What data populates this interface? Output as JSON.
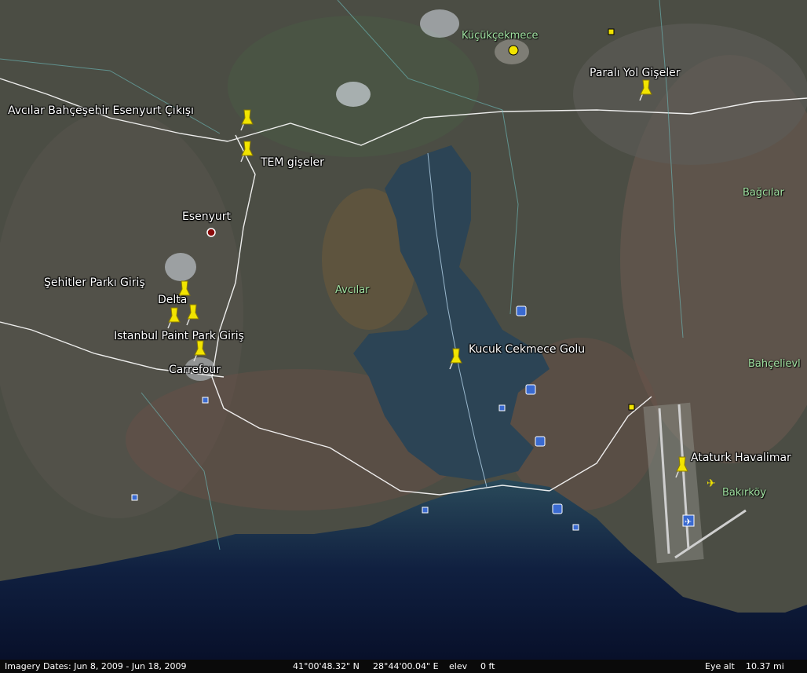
{
  "places": {
    "kucukcekmece": "Küçükçekmece",
    "bagcilar": "Bağcılar",
    "avcilar": "Avcılar",
    "bahcelievler": "Bahçelievl",
    "bakirkoy": "Bakırköy",
    "esenyurt": "Esenyurt"
  },
  "placemarks": {
    "avcilar_cikisi": "Avcılar Bahçeşehir Esenyurt Çıkışı",
    "tem_giseler": "TEM gişeler",
    "parali_yol": "Paralı Yol Gişeler",
    "sehitler_parki": "Şehitler Parkı Giriş",
    "delta": "Delta",
    "paint_park": "Istanbul Paint Park Giriş",
    "carrefour": "Carrefour",
    "kucuk_cekmece_golu": "Kucuk Cekmece Golu",
    "ataturk": "Ataturk Havalimar"
  },
  "status": {
    "imagery_dates": "Imagery Dates: Jun  8, 2009 - Jun 18, 2009",
    "lat": "41°00'48.32\" N",
    "lon": "28°44'00.04\" E",
    "elev_label": "elev",
    "elev_value": "0 ft",
    "eye_alt_label": "Eye alt",
    "eye_alt_value": "10.37 mi"
  },
  "colors": {
    "pin": "#f2e400",
    "town_label": "#9fe0a0",
    "road": "#ffffff",
    "water": "#1e3548",
    "sea": "#0d1b33",
    "land": "#4a4a40"
  }
}
